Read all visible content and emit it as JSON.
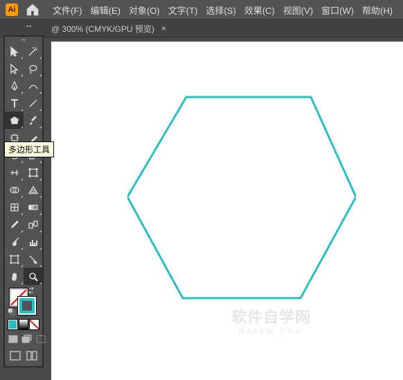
{
  "app": {
    "logo": "Ai"
  },
  "menu": {
    "items": [
      {
        "label": "文件(F)"
      },
      {
        "label": "编辑(E)"
      },
      {
        "label": "对象(O)"
      },
      {
        "label": "文字(T)"
      },
      {
        "label": "选择(S)"
      },
      {
        "label": "效果(C)"
      },
      {
        "label": "视图(V)"
      },
      {
        "label": "窗口(W)"
      },
      {
        "label": "帮助(H)"
      }
    ]
  },
  "document": {
    "tab_label": "@ 300% (CMYK/GPU 预览)"
  },
  "tooltip": {
    "polygon": "多边形工具"
  },
  "swatches": {
    "stroke_color": "#27bfc4"
  },
  "watermark": {
    "line1": "软件自学网",
    "line2": "RJZXW.COM"
  },
  "tools": [
    {
      "n": "selection-tool",
      "t": true
    },
    {
      "n": "magic-wand-tool",
      "t": true
    },
    {
      "n": "direct-selection-tool",
      "t": true
    },
    {
      "n": "lasso-tool",
      "t": true
    },
    {
      "n": "pen-tool",
      "t": true
    },
    {
      "n": "curvature-tool",
      "t": true
    },
    {
      "n": "type-tool",
      "t": true
    },
    {
      "n": "line-tool",
      "t": true
    },
    {
      "n": "polygon-tool",
      "t": true,
      "sel": true
    },
    {
      "n": "paintbrush-tool",
      "t": true
    },
    {
      "n": "shaper-tool",
      "t": true
    },
    {
      "n": "eraser-tool",
      "t": true
    },
    {
      "n": "rotate-tool",
      "t": true
    },
    {
      "n": "scale-tool",
      "t": true
    },
    {
      "n": "width-tool",
      "t": true
    },
    {
      "n": "free-transform-tool",
      "t": true
    },
    {
      "n": "shape-builder-tool",
      "t": true
    },
    {
      "n": "perspective-grid-tool",
      "t": true
    },
    {
      "n": "mesh-tool",
      "t": true
    },
    {
      "n": "gradient-tool",
      "t": true
    },
    {
      "n": "eyedropper-tool",
      "t": true
    },
    {
      "n": "blend-tool",
      "t": true
    },
    {
      "n": "symbol-sprayer-tool",
      "t": true
    },
    {
      "n": "graph-tool",
      "t": true
    },
    {
      "n": "artboard-tool",
      "t": true
    },
    {
      "n": "slice-tool",
      "t": true
    },
    {
      "n": "hand-tool",
      "t": true
    },
    {
      "n": "zoom-tool",
      "t": true,
      "sel": true
    }
  ]
}
